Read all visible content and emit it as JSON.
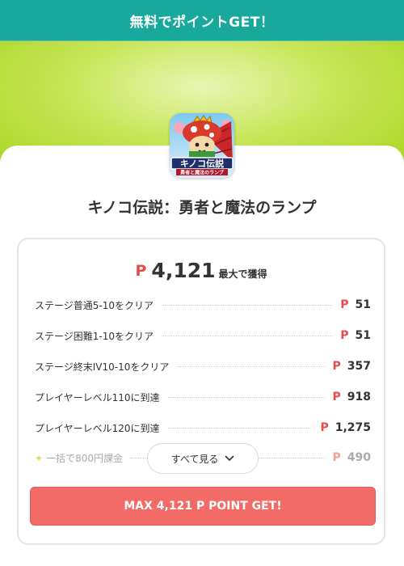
{
  "header": {
    "title": "無料でポイントGET！"
  },
  "app": {
    "title": "キノコ伝説：勇者と魔法のランプ",
    "icon_text_main": "キノコ伝説",
    "icon_text_sub": "勇者と魔法のランプ"
  },
  "card": {
    "currency_symbol": "P",
    "total_points": "4,121",
    "total_suffix": "最大で獲得",
    "rows": [
      {
        "label": "ステージ普通5-10をクリア",
        "points": "51"
      },
      {
        "label": "ステージ困難1-10をクリア",
        "points": "51"
      },
      {
        "label": "ステージ終末IV10-10をクリア",
        "points": "357"
      },
      {
        "label": "プレイヤーレベル110に到達",
        "points": "918"
      },
      {
        "label": "プレイヤーレベル120に到達",
        "points": "1,275"
      },
      {
        "label": "一括で800円課金",
        "points": "490"
      }
    ],
    "see_all_label": "すべて見る",
    "cta_label": "MAX 4,121 P POINT GET!"
  }
}
